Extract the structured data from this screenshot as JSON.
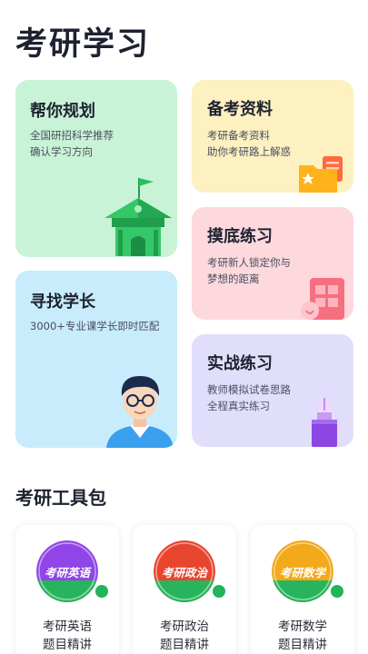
{
  "page": {
    "title": "考研学习"
  },
  "cards": {
    "plan": {
      "title": "帮你规划",
      "desc1": "全国研招科学推荐",
      "desc2": "确认学习方向",
      "icon": "school-building-icon"
    },
    "senior": {
      "title": "寻找学长",
      "desc1": "3000+专业课学长即时匹配",
      "icon": "senior-avatar-icon"
    },
    "mater": {
      "title": "备考资料",
      "desc1": "考研备考资料",
      "desc2": "助你考研路上解惑",
      "icon": "folder-star-icon"
    },
    "mock": {
      "title": "摸底练习",
      "desc1": "考研新人锁定你与",
      "desc2": "梦想的距离",
      "icon": "clipboard-icon"
    },
    "prac": {
      "title": "实战练习",
      "desc1": "教师模拟试卷思路",
      "desc2": "全程真实练习",
      "icon": "fountain-pen-icon"
    }
  },
  "toolkit": {
    "title": "考研工具包",
    "items": [
      {
        "badge": "考研英语",
        "line1": "考研英语",
        "line2": "题目精讲",
        "color": "#8f45e8"
      },
      {
        "badge": "考研政治",
        "line1": "考研政治",
        "line2": "题目精讲",
        "color": "#e8452f"
      },
      {
        "badge": "考研数学",
        "line1": "考研数学",
        "line2": "题目精讲",
        "color": "#f2a91a"
      }
    ]
  }
}
